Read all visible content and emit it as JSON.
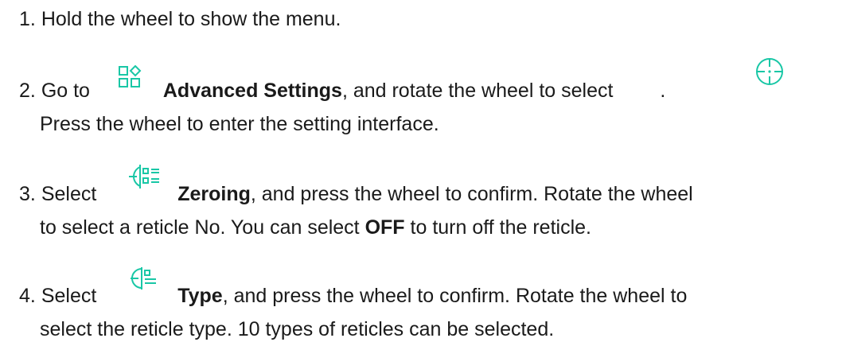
{
  "colors": {
    "text": "#1a1a1a",
    "icon": "#19c7a6"
  },
  "steps": [
    {
      "number": "1.",
      "text": "Hold the wheel to show the menu."
    },
    {
      "number": "2.",
      "lead": "Go to",
      "icon_1": "advanced-settings-icon",
      "bold": "Advanced Settings",
      "after_bold": ", and rotate the wheel to select",
      "icon_2": "crosshair-icon",
      "end": ".",
      "line2": "Press the wheel to enter the setting interface."
    },
    {
      "number": "3.",
      "lead": "Select",
      "icon": "zeroing-icon",
      "bold": "Zeroing",
      "after_bold": ", and press the wheel to confirm. Rotate the wheel",
      "line2_pre": "to select a reticle No. You can select",
      "line2_bold": "OFF",
      "line2_post": "to turn off the reticle."
    },
    {
      "number": "4.",
      "lead": "Select",
      "icon": "type-icon",
      "bold": "Type",
      "after_bold": ", and press the wheel to confirm. Rotate the wheel to",
      "line2": "select the reticle type. 10 types of reticles can be selected."
    }
  ]
}
